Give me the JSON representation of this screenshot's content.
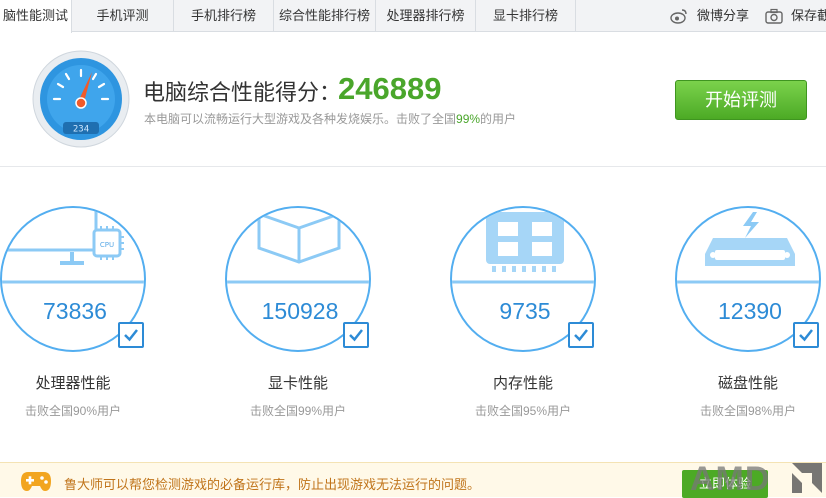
{
  "tabs": [
    {
      "label": "脑性能测试",
      "active": true
    },
    {
      "label": "手机评测"
    },
    {
      "label": "手机排行榜"
    },
    {
      "label": "综合性能排行榜"
    },
    {
      "label": "处理器排行榜"
    },
    {
      "label": "显卡排行榜"
    }
  ],
  "tabs_right": {
    "weibo": "微博分享",
    "save": "保存截"
  },
  "header": {
    "score_label": "电脑综合性能得分：",
    "score_value": "246889",
    "subtitle_prefix": "本电脑可以流畅运行大型游戏及各种发烧娱乐。击败了全国",
    "subtitle_pct": "99%",
    "subtitle_suffix": "的用户",
    "start_button": "开始评测",
    "gauge_digits": "234"
  },
  "cards": [
    {
      "icon": "cpu-monitor-icon",
      "value": "73836",
      "name": "处理器性能",
      "sub": "击败全国90%用户"
    },
    {
      "icon": "graphics-card-icon",
      "value": "150928",
      "name": "显卡性能",
      "sub": "击败全国99%用户"
    },
    {
      "icon": "memory-icon",
      "value": "9735",
      "name": "内存性能",
      "sub": "击败全国95%用户"
    },
    {
      "icon": "hard-disk-icon",
      "value": "12390",
      "name": "磁盘性能",
      "sub": "击败全国98%用户"
    }
  ],
  "notice": {
    "text": "鲁大师可以帮您检测游戏的必备运行库，防止出现游戏无法运行的问题。",
    "button": "立即体验"
  },
  "logo": {
    "text": "AMD"
  },
  "colors": {
    "accent": "#2d8bd6",
    "green": "#4aa62b",
    "notice": "#c0741a"
  }
}
